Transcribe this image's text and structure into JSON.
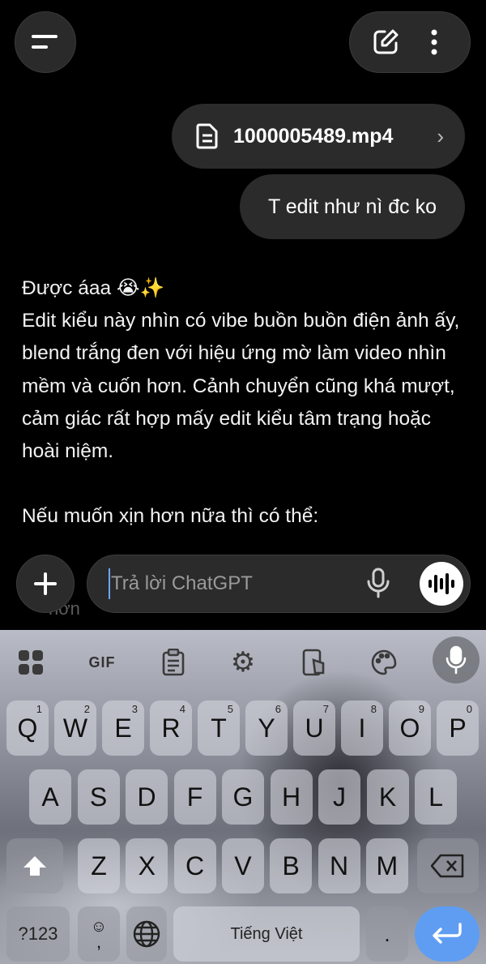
{
  "header": {
    "menu_icon": "hamburger-icon",
    "new_chat_icon": "edit-icon",
    "more_icon": "more-vertical-icon"
  },
  "messages": {
    "attachment": {
      "filename": "1000005489.mp4",
      "icon": "document-icon"
    },
    "user_text": "T edit như nì đc ko"
  },
  "reply": {
    "line1": "Được áaa 😭✨",
    "para1": "Edit kiểu này nhìn có vibe buồn buồn điện ảnh ấy, blend trắng đen với hiệu ứng mờ làm video nhìn mềm và cuốn hơn. Cảnh chuyển cũng khá mượt, cảm giác rất hợp mấy edit kiểu tâm trạng hoặc hoài niệm.",
    "para2": "Nếu muốn xịn hơn nữa thì có thể:",
    "faded_text": "hơn"
  },
  "composer": {
    "placeholder": "Trả lời ChatGPT",
    "colors": {
      "caret": "#6da6ff"
    }
  },
  "keyboard": {
    "toolbar": [
      "apps-icon",
      "gif-icon",
      "clipboard-icon",
      "settings-icon",
      "one-hand-icon",
      "theme-icon",
      "mic-icon"
    ],
    "gif_label": "GIF",
    "row1": [
      {
        "k": "Q",
        "s": "1"
      },
      {
        "k": "W",
        "s": "2"
      },
      {
        "k": "E",
        "s": "3"
      },
      {
        "k": "R",
        "s": "4"
      },
      {
        "k": "T",
        "s": "5"
      },
      {
        "k": "Y",
        "s": "6"
      },
      {
        "k": "U",
        "s": "7"
      },
      {
        "k": "I",
        "s": "8"
      },
      {
        "k": "O",
        "s": "9"
      },
      {
        "k": "P",
        "s": "0"
      }
    ],
    "row2": [
      "A",
      "S",
      "D",
      "F",
      "G",
      "H",
      "J",
      "K",
      "L"
    ],
    "row3": [
      "Z",
      "X",
      "C",
      "V",
      "B",
      "N",
      "M"
    ],
    "sym_label": "?123",
    "space_label": "Tiếng Việt",
    "period_label": ".",
    "comma_label": ",",
    "colors": {
      "enter": "#5f9df2"
    }
  }
}
